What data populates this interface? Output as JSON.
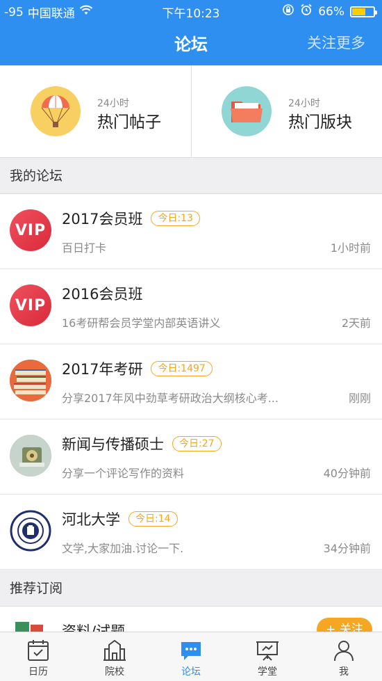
{
  "status": {
    "signal": "-95",
    "carrier": "中国联通",
    "time": "下午10:23",
    "battery": "66%",
    "battery_level": 0.66
  },
  "nav": {
    "title": "论坛",
    "right": "关注更多"
  },
  "hot": [
    {
      "small": "24小时",
      "big": "热门帖子",
      "icon": "parachute-icon",
      "color": "#f8cf61"
    },
    {
      "small": "24小时",
      "big": "热门版块",
      "icon": "folder-icon",
      "color": "#8fd6d5"
    }
  ],
  "my_forum": {
    "header": "我的论坛",
    "items": [
      {
        "title": "2017会员班",
        "badge": "今日:13",
        "desc": "百日打卡",
        "time": "1小时前",
        "avatar": "VIP"
      },
      {
        "title": "2016会员班",
        "badge": "",
        "desc": "16考研帮会员学堂内部英语讲义",
        "time": "2天前",
        "avatar": "VIP"
      },
      {
        "title": "2017年考研",
        "badge": "今日:1497",
        "desc": "分享2017年风中劲草考研政治大纲核心考...",
        "time": "刚刚",
        "avatar": "books-icon"
      },
      {
        "title": "新闻与传播硕士",
        "badge": "今日:27",
        "desc": "分享一个评论写作的资料",
        "time": "40分钟前",
        "avatar": "radio-photo"
      },
      {
        "title": "河北大学",
        "badge": "今日:14",
        "desc": "文学,大家加油.讨论一下.",
        "time": "34分钟前",
        "avatar": "university-seal"
      }
    ]
  },
  "recommend": {
    "header": "推荐订阅",
    "item_title": "资料/试题",
    "follow": "+ 关注"
  },
  "tabs": [
    {
      "label": "日历",
      "icon": "calendar-icon"
    },
    {
      "label": "院校",
      "icon": "school-icon"
    },
    {
      "label": "论坛",
      "icon": "chat-icon",
      "active": true
    },
    {
      "label": "学堂",
      "icon": "board-icon"
    },
    {
      "label": "我",
      "icon": "person-icon"
    }
  ]
}
